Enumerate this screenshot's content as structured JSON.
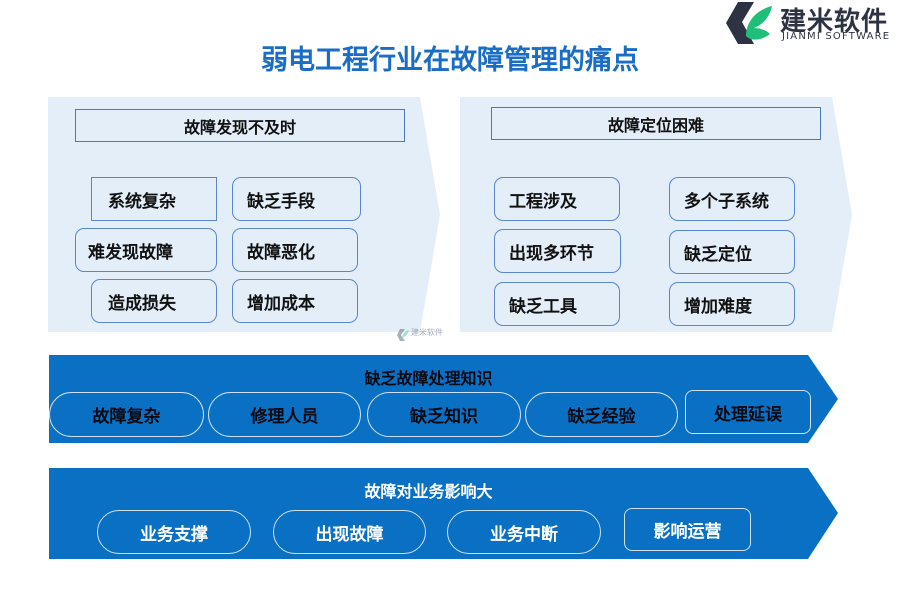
{
  "title": "弱电工程行业在故障管理的痛点",
  "logo": {
    "name_cn": "建米软件",
    "name_en": "JIANMI SOFTWARE",
    "icon": "jianmi-logo-icon"
  },
  "watermark": {
    "text": "建米软件"
  },
  "colors": {
    "title": "#1a6dc4",
    "panel_bg": "#e3eef8",
    "band_bg": "#0a70c3",
    "border": "#5a86cf"
  },
  "panels": [
    {
      "header": "故障发现不及时",
      "items": [
        "系统复杂",
        "缺乏手段",
        "难发现故障",
        "故障恶化",
        "造成损失",
        "增加成本"
      ]
    },
    {
      "header": "故障定位困难",
      "items": [
        "工程涉及",
        "多个子系统",
        "出现多环节",
        "缺乏定位",
        "缺乏工具",
        "增加难度"
      ]
    }
  ],
  "bands": [
    {
      "title": "缺乏故障处理知识",
      "items": [
        "故障复杂",
        "修理人员",
        "缺乏知识",
        "缺乏经验",
        "处理延误"
      ]
    },
    {
      "title": "故障对业务影响大",
      "items": [
        "业务支撑",
        "出现故障",
        "业务中断",
        "影响运营"
      ]
    }
  ]
}
